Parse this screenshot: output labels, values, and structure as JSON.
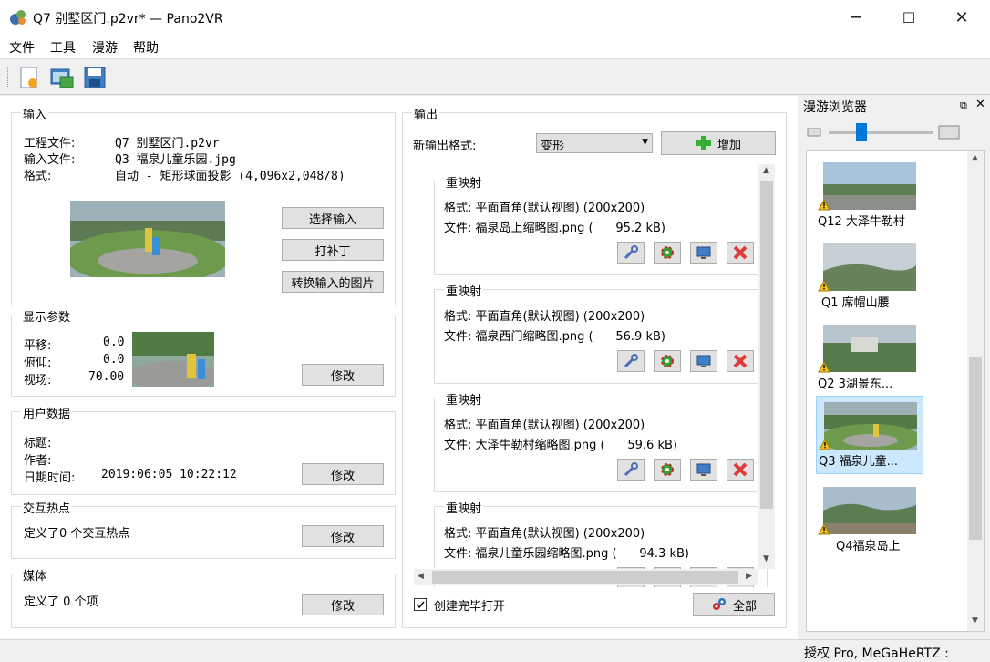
{
  "window": {
    "title": "Q7 别墅区门.p2vr* — Pano2VR",
    "minimize_icon": "─",
    "maximize_icon": "☐",
    "close_icon": "✕"
  },
  "menu": [
    "文件",
    "工具",
    "漫游",
    "帮助"
  ],
  "toolbar": {
    "icons": [
      "new-project-icon",
      "open-project-icon",
      "save-icon"
    ]
  },
  "input": {
    "title": "输入",
    "project_label": "工程文件:",
    "project_value": "Q7 别墅区门.p2vr",
    "file_label": "输入文件:",
    "file_value": "Q3 福泉儿童乐园.jpg",
    "format_label": "格式:",
    "format_value": "自动 - 矩形球面投影 (4,096x2,048/8)",
    "select_button": "选择输入",
    "patch_button": "打补丁",
    "convert_button": "转换输入的图片"
  },
  "display": {
    "title": "显示参数",
    "pan_label": "平移:",
    "pan_value": "0.0",
    "tilt_label": "俯仰:",
    "tilt_value": "0.0",
    "fov_label": "视场:",
    "fov_value": "70.00",
    "modify_button": "修改"
  },
  "userdata": {
    "title": "用户数据",
    "title_label": "标题:",
    "author_label": "作者:",
    "datetime_label": "日期时间:",
    "datetime_value": "2019:06:05 10:22:12",
    "modify_button": "修改"
  },
  "hotspots": {
    "title": "交互热点",
    "text": "定义了0 个交互热点",
    "modify_button": "修改"
  },
  "media": {
    "title": "媒体",
    "text": "定义了 0 个项",
    "modify_button": "修改"
  },
  "output": {
    "title": "输出",
    "new_format_label": "新输出格式:",
    "format_select": "变形",
    "add_button": "增加",
    "remaps": [
      {
        "title": "重映射",
        "format": "格式: 平面直角(默认视图) (200x200)",
        "file": "文件: 福泉岛上缩略图.png (      95.2 kB)"
      },
      {
        "title": "重映射",
        "format": "格式: 平面直角(默认视图) (200x200)",
        "file": "文件: 福泉西门缩略图.png (      56.9 kB)"
      },
      {
        "title": "重映射",
        "format": "格式: 平面直角(默认视图) (200x200)",
        "file": "文件: 大泽牛勒村缩略图.png (      59.6 kB)"
      },
      {
        "title": "重映射",
        "format": "格式: 平面直角(默认视图) (200x200)",
        "file": "文件: 福泉儿童乐园缩略图.png (      94.3 kB)"
      }
    ],
    "open_after_label": "创建完毕打开",
    "open_after_checked": true,
    "all_button": "全部"
  },
  "tour_browser": {
    "title": "漫游浏览器",
    "items": [
      {
        "label": "Q12 大泽牛勒村"
      },
      {
        "label": "Q1 席帽山腰"
      },
      {
        "label": "Q2  3湖景东..."
      },
      {
        "label": "Q3 福泉儿童..."
      },
      {
        "label": "Q4福泉岛上"
      }
    ],
    "selected_index": 3
  },
  "status": {
    "license": "授权 Pro, MeGaHeRTZ :"
  },
  "colors": {
    "accent": "#0078d7",
    "selected_item": "#cce8ff",
    "add_green": "#35b032",
    "delete_red": "#e03a3a"
  }
}
